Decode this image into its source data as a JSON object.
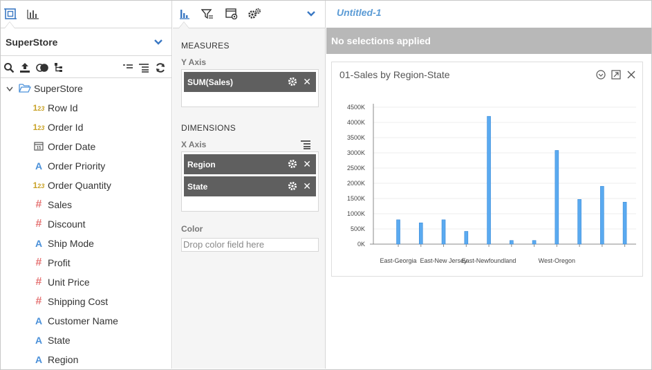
{
  "left_panel": {
    "datasource_name": "SuperStore",
    "tree_root": "SuperStore",
    "fields": [
      {
        "name": "Row Id",
        "type": "number"
      },
      {
        "name": "Order Id",
        "type": "number"
      },
      {
        "name": "Order Date",
        "type": "date"
      },
      {
        "name": "Order Priority",
        "type": "string"
      },
      {
        "name": "Order Quantity",
        "type": "number"
      },
      {
        "name": "Sales",
        "type": "measure"
      },
      {
        "name": "Discount",
        "type": "measure"
      },
      {
        "name": "Ship Mode",
        "type": "string"
      },
      {
        "name": "Profit",
        "type": "measure"
      },
      {
        "name": "Unit Price",
        "type": "measure"
      },
      {
        "name": "Shipping Cost",
        "type": "measure"
      },
      {
        "name": "Customer Name",
        "type": "string"
      },
      {
        "name": "State",
        "type": "string"
      },
      {
        "name": "Region",
        "type": "string"
      }
    ],
    "type_glyphs": {
      "number": "123",
      "date": "15",
      "string": "A",
      "measure": "#"
    }
  },
  "middle_panel": {
    "measures_title": "MEASURES",
    "y_axis_label": "Y Axis",
    "y_fields": [
      "SUM(Sales)"
    ],
    "dimensions_title": "DIMENSIONS",
    "x_axis_label": "X Axis",
    "x_fields": [
      "Region",
      "State"
    ],
    "color_label": "Color",
    "color_placeholder": "Drop color field here",
    "remove_glyph": "✕"
  },
  "right_panel": {
    "document_title": "Untitled-1",
    "selection_status": "No selections applied",
    "widget_title": "01-Sales by Region-State"
  },
  "colors": {
    "accent": "#3a78c3",
    "bar": "#5aaaf0",
    "bar_stroke": "#3a8ad8",
    "selection_bar": "#b8b8b8",
    "pill": "#5f5f5f"
  },
  "chart_data": {
    "type": "bar",
    "title": "01-Sales by Region-State",
    "categories": [
      "East-Georgia",
      "",
      "East-New Jersey",
      "",
      "East-Newfoundland",
      "",
      "",
      "West-Oregon",
      "",
      "",
      ""
    ],
    "x_tick_labels": [
      "East-Georgia",
      "East-New Jersey",
      "East-Newfoundland",
      "West-Oregon"
    ],
    "values": [
      800000,
      700000,
      800000,
      420000,
      4200000,
      120000,
      120000,
      3080000,
      1470000,
      1900000,
      1380000
    ],
    "y_ticks": [
      "0K",
      "500K",
      "1000K",
      "1500K",
      "2000K",
      "2500K",
      "3000K",
      "3500K",
      "4000K",
      "4500K"
    ],
    "ylim": [
      0,
      4500000
    ],
    "grid": true,
    "xlabel": "",
    "ylabel": ""
  }
}
